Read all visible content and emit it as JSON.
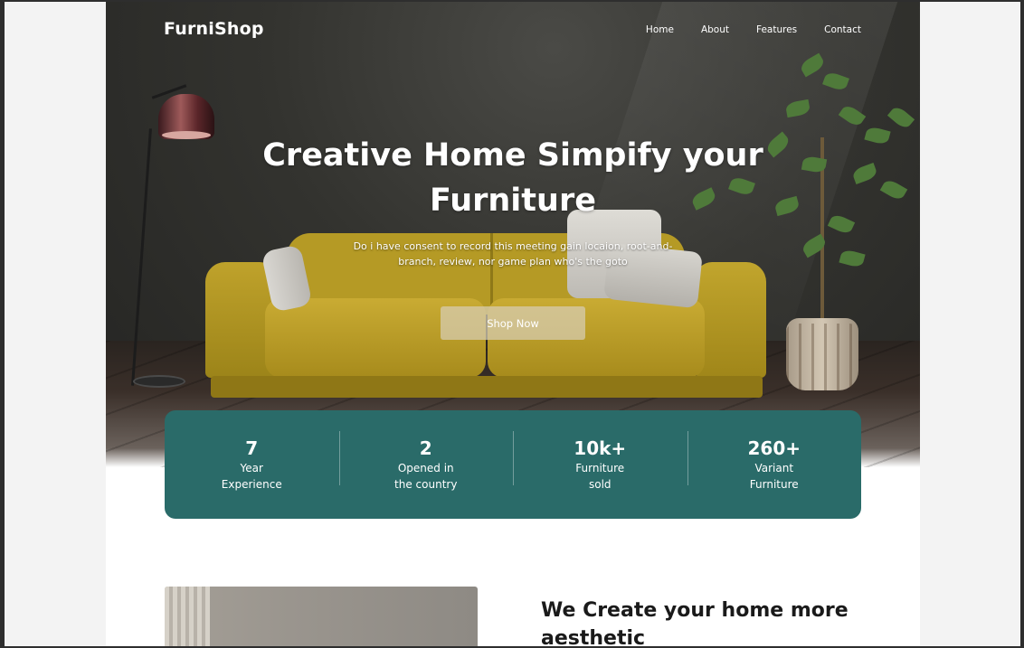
{
  "brand": {
    "logo_text": "FurniShop"
  },
  "nav": {
    "items": [
      {
        "label": "Home"
      },
      {
        "label": "About"
      },
      {
        "label": "Features"
      },
      {
        "label": "Contact"
      }
    ]
  },
  "hero": {
    "title": "Creative Home Simpify your Furniture",
    "subtitle": "Do i have consent to record this meeting gain locaion, root-and-branch, review, nor game plan who's the goto",
    "cta_label": "Shop Now"
  },
  "stats": [
    {
      "value": "7",
      "label": "Year Experience"
    },
    {
      "value": "2",
      "label": "Opened in the country"
    },
    {
      "value": "10k+",
      "label": "Furniture sold"
    },
    {
      "value": "260+",
      "label": "Variant Furniture"
    }
  ],
  "about": {
    "title": "We Create your home more aesthetic"
  },
  "colors": {
    "accent_teal": "#2a6b69",
    "sofa_yellow": "#c9ab33",
    "button_beige": "#d7cdb4"
  },
  "icons": [
    "lamp-illustration",
    "sofa-illustration",
    "plant-illustration"
  ]
}
